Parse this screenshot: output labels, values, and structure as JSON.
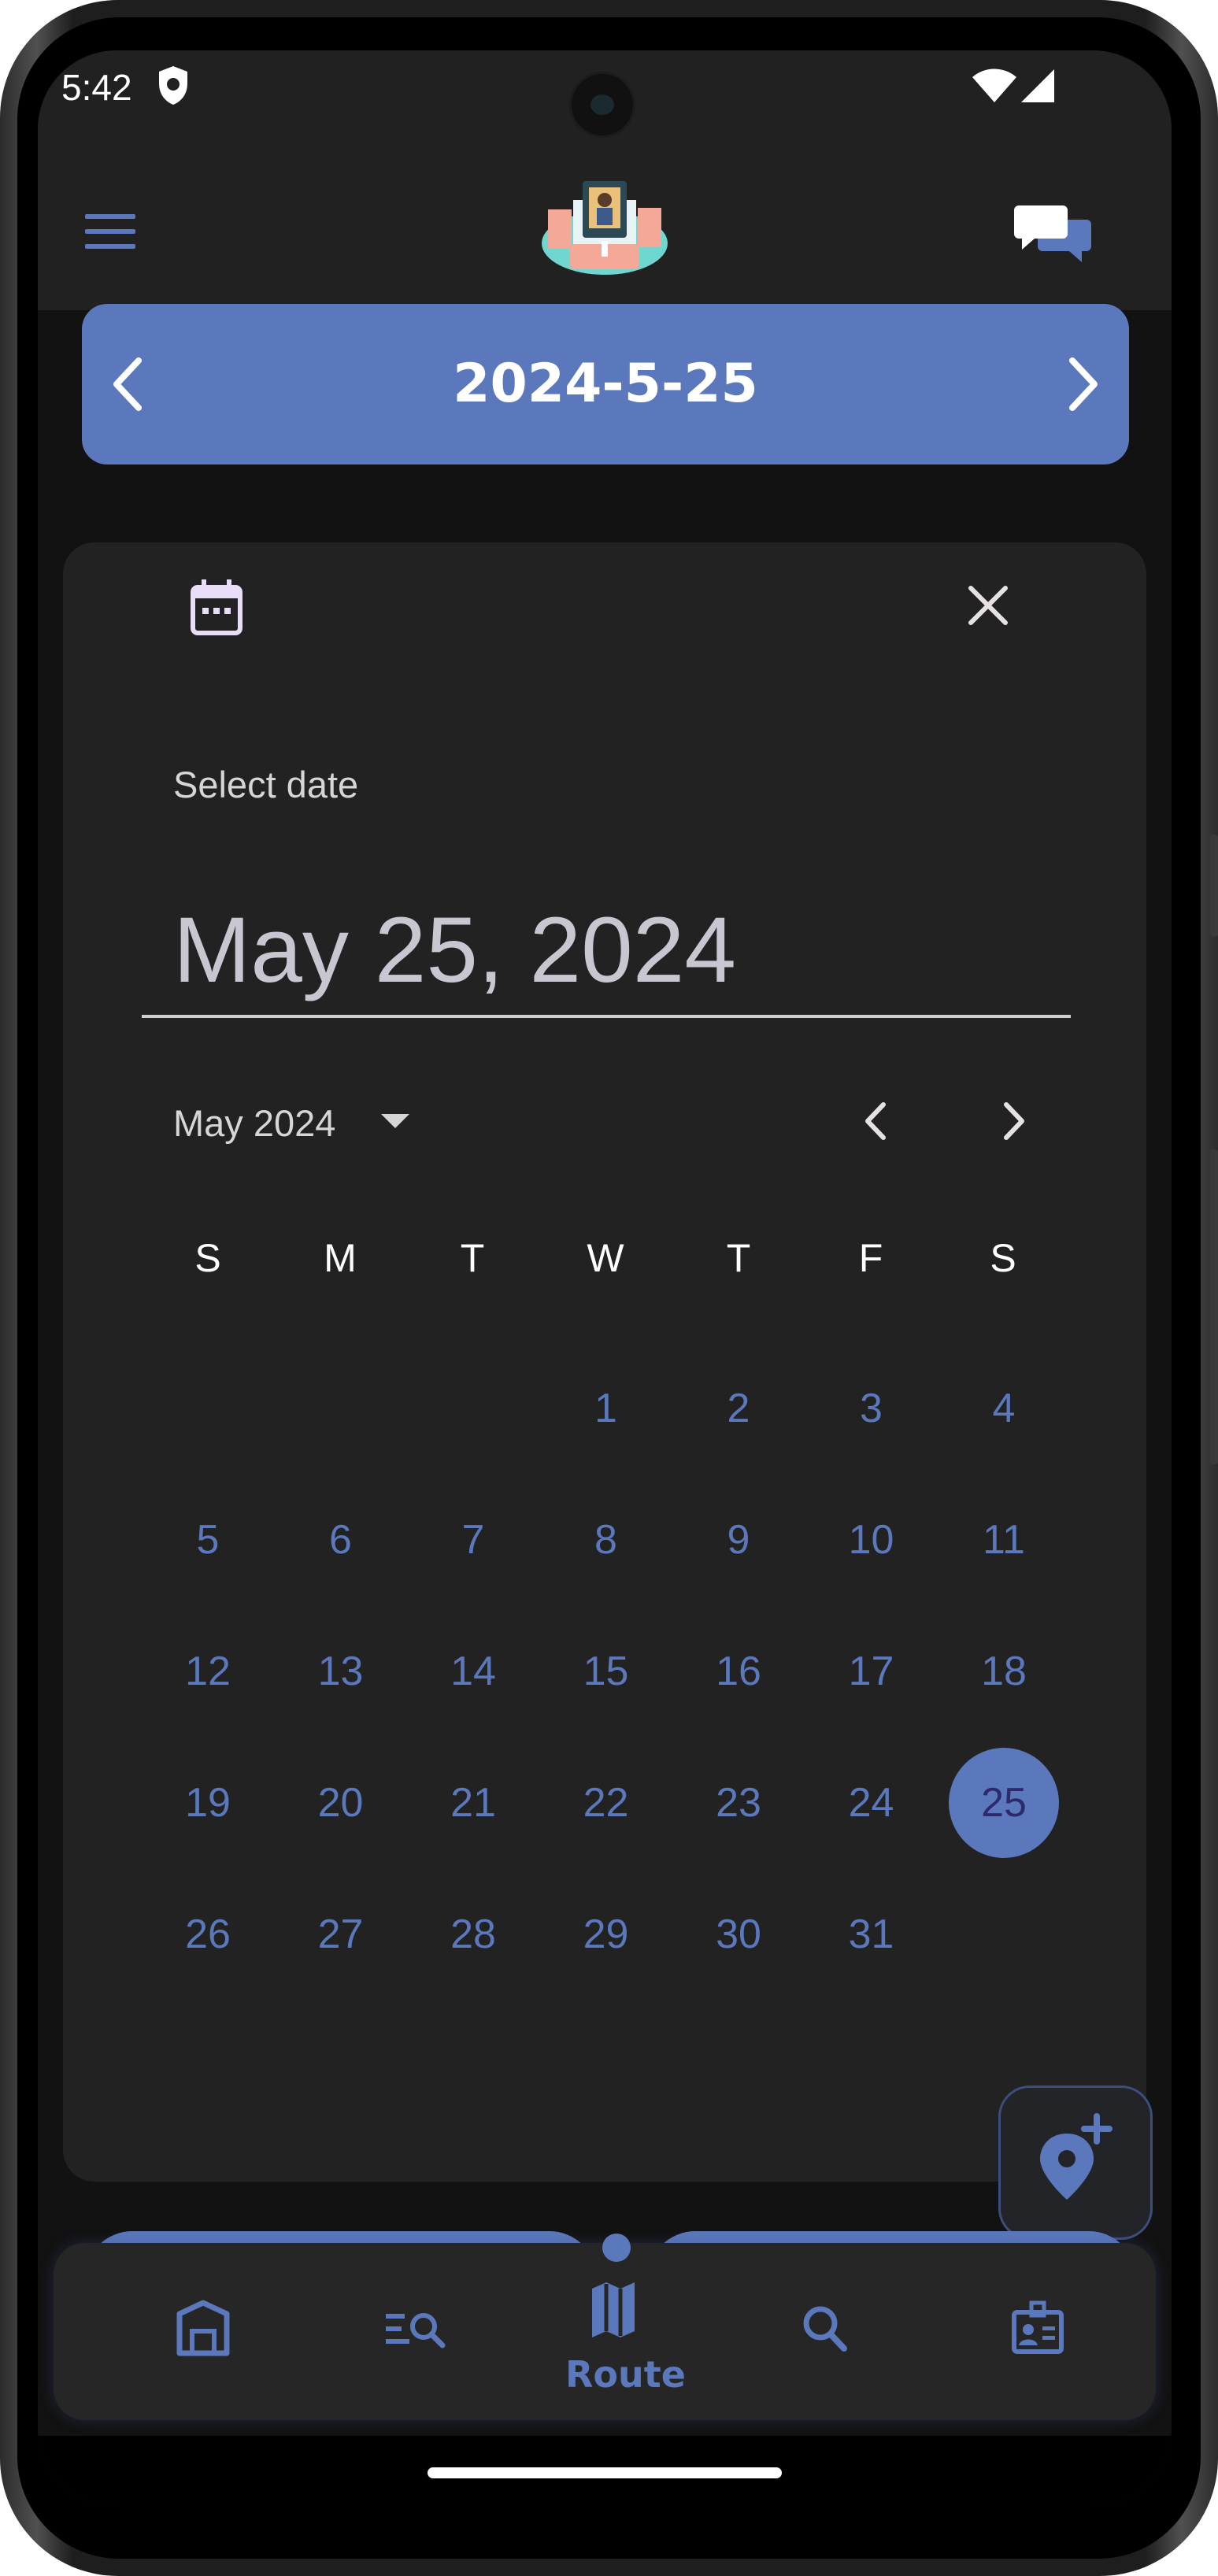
{
  "status_bar": {
    "time": "5:42"
  },
  "date_bar": {
    "title": "2024-5-25"
  },
  "dialog": {
    "label": "Select date",
    "date_value": "May 25, 2024",
    "month_label": "May 2024",
    "weekdays": [
      "S",
      "M",
      "T",
      "W",
      "T",
      "F",
      "S"
    ],
    "days": [
      "1",
      "2",
      "3",
      "4",
      "5",
      "6",
      "7",
      "8",
      "9",
      "10",
      "11",
      "12",
      "13",
      "14",
      "15",
      "16",
      "17",
      "18",
      "19",
      "20",
      "21",
      "22",
      "23",
      "24",
      "25",
      "26",
      "27",
      "28",
      "29",
      "30",
      "31"
    ],
    "selected_day": "25"
  },
  "bottom_nav": {
    "active_label": "Route"
  },
  "colors": {
    "accent": "#5a78bb",
    "background": "#121212",
    "surface": "#222222",
    "selected_day_text": "#2c2a6b"
  },
  "icons": [
    "shield-icon",
    "wifi-icon",
    "signal-icon",
    "menu-icon",
    "app-logo",
    "chat-icon",
    "chevron-left-icon",
    "chevron-right-icon",
    "calendar-icon",
    "close-icon",
    "dropdown-caret-icon",
    "add-location-icon",
    "store-icon",
    "list-search-icon",
    "map-icon",
    "search-icon",
    "contact-card-icon"
  ]
}
